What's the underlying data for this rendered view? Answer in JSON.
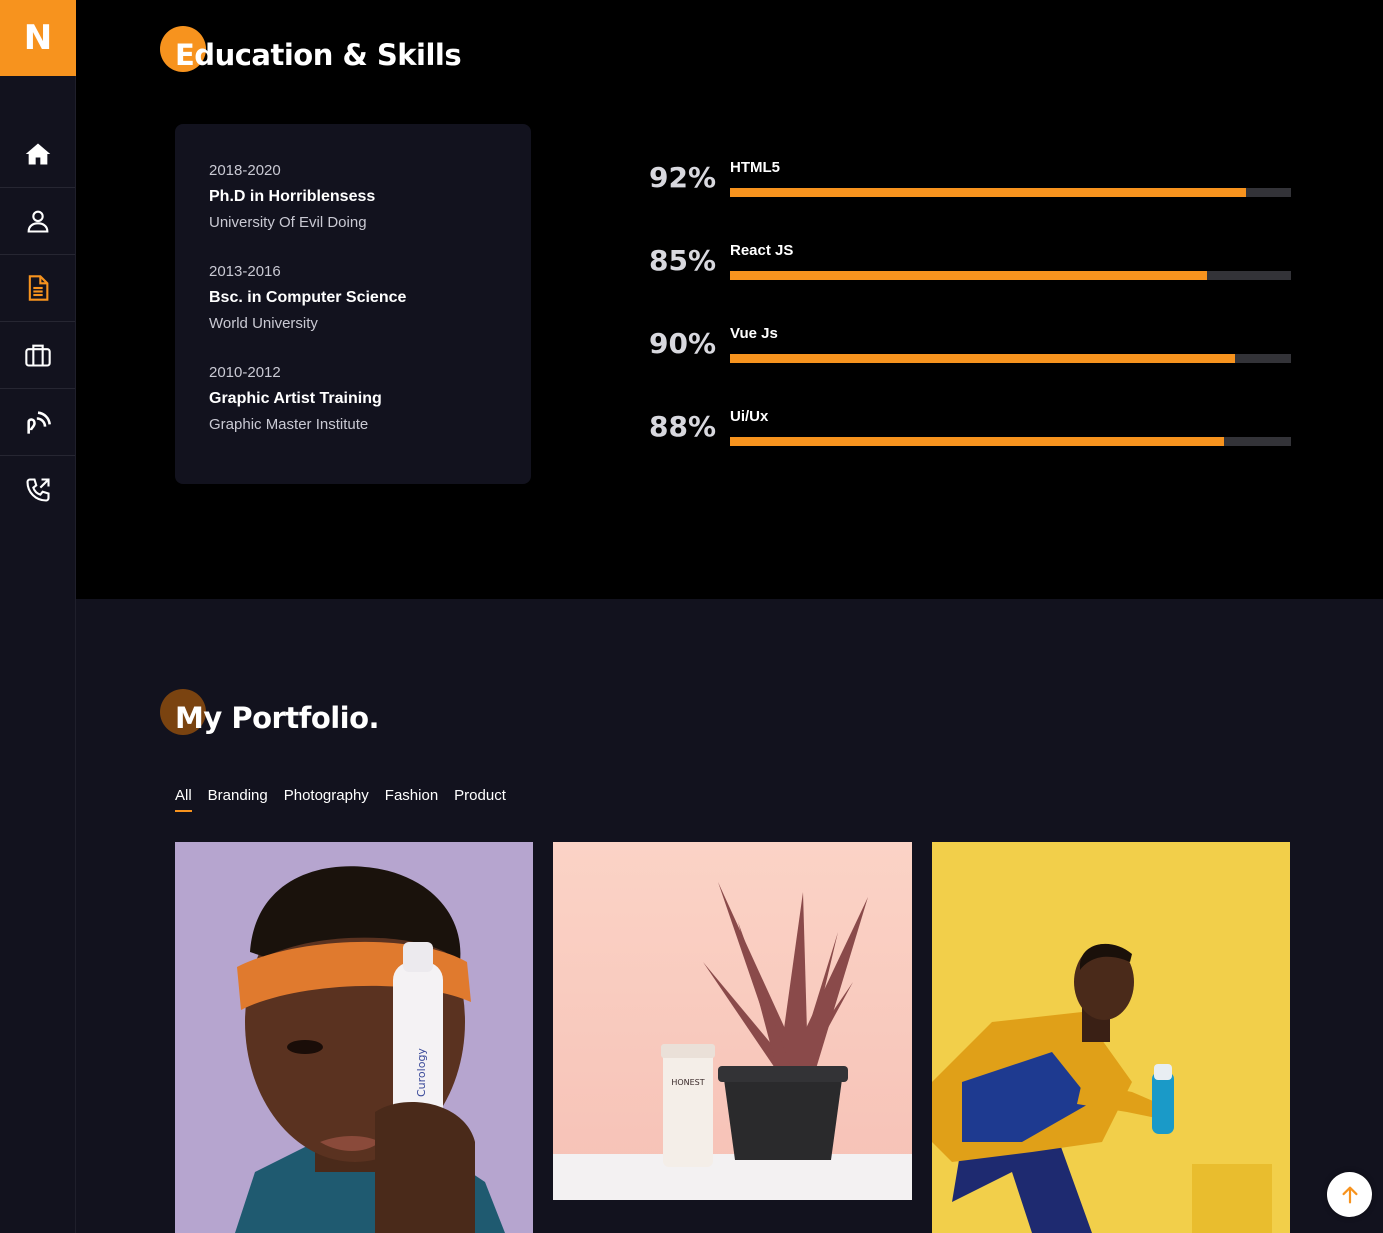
{
  "brand": {
    "logo_letter": "N",
    "accent": "#f7931e"
  },
  "sidebar": {
    "items": [
      {
        "name": "home",
        "icon": "home-icon"
      },
      {
        "name": "about",
        "icon": "user-icon"
      },
      {
        "name": "resume",
        "icon": "document-icon",
        "active": true
      },
      {
        "name": "portfolio",
        "icon": "briefcase-icon"
      },
      {
        "name": "blog",
        "icon": "rss-icon"
      },
      {
        "name": "contact",
        "icon": "phone-icon"
      }
    ]
  },
  "education": {
    "title": "Education & Skills",
    "items": [
      {
        "years": "2018-2020",
        "degree": "Ph.D in Horriblensess",
        "school": "University Of Evil Doing"
      },
      {
        "years": "2013-2016",
        "degree": "Bsc. in Computer Science",
        "school": "World University"
      },
      {
        "years": "2010-2012",
        "degree": "Graphic Artist Training",
        "school": "Graphic Master Institute"
      }
    ]
  },
  "skills": [
    {
      "name": "HTML5",
      "percent_label": "92%",
      "percent": 92
    },
    {
      "name": "React JS",
      "percent_label": "85%",
      "percent": 85
    },
    {
      "name": "Vue Js",
      "percent_label": "90%",
      "percent": 90
    },
    {
      "name": "Ui/Ux",
      "percent_label": "88%",
      "percent": 88
    }
  ],
  "portfolio": {
    "title": "My Portfolio.",
    "filters": [
      "All",
      "Branding",
      "Photography",
      "Fashion",
      "Product"
    ],
    "active_filter": "All",
    "items": [
      {
        "image": "man-with-orange-headband-holding-bottle",
        "bottle_text": "Curology"
      },
      {
        "image": "potted-aloe-plant-with-tube",
        "tube_text": "HONEST"
      },
      {
        "image": "man-running-with-bottle-yellow-background"
      }
    ]
  },
  "scroll_top": {
    "icon": "arrow-up-icon"
  }
}
